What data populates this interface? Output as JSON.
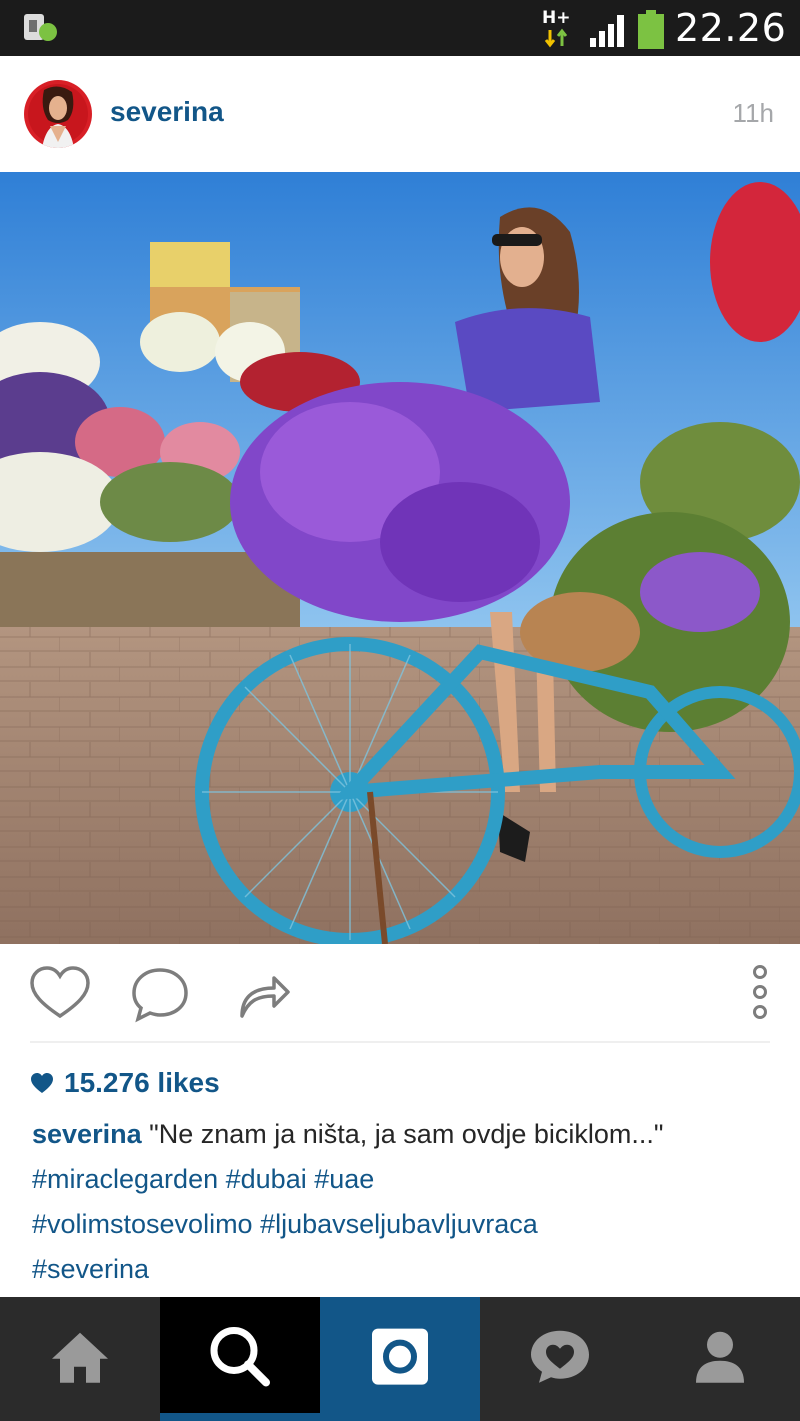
{
  "status_bar": {
    "network": "H+",
    "time": "22.26",
    "notification_icon": "sim-card-icon"
  },
  "post": {
    "username": "severina",
    "time_ago": "11h",
    "photo_description_icon": "photo",
    "likes": "15.276 likes",
    "caption": {
      "username": "severina",
      "text": "\"Ne znam ja ništa, ja sam ovdje biciklom...\"",
      "hashtags_line1": [
        "#miraclegarden",
        "#dubai",
        "#uae"
      ],
      "hashtags_line2": [
        "#volimstosevolimo",
        "#ljubavseljubavljuvraca"
      ],
      "hashtags_line3": [
        "#severina"
      ]
    }
  },
  "actions": [
    "heart-icon",
    "comment-icon",
    "share-icon",
    "more-icon"
  ],
  "nav": [
    "home",
    "search",
    "camera",
    "activity",
    "profile"
  ],
  "colors": {
    "brand_blue": "#125688",
    "status_bar": "#1b1b1b",
    "nav_bg": "#2b2b2b"
  }
}
